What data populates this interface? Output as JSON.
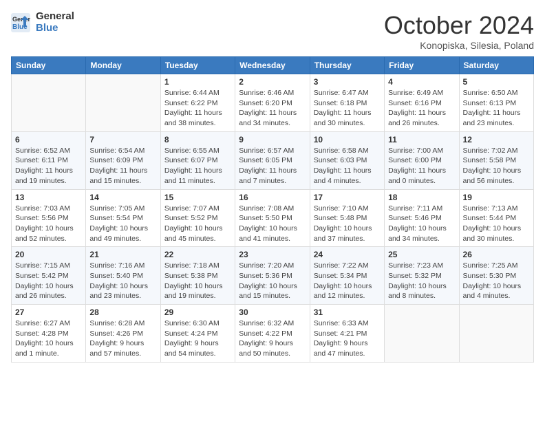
{
  "header": {
    "logo_line1": "General",
    "logo_line2": "Blue",
    "month_title": "October 2024",
    "location": "Konopiska, Silesia, Poland"
  },
  "days_of_week": [
    "Sunday",
    "Monday",
    "Tuesday",
    "Wednesday",
    "Thursday",
    "Friday",
    "Saturday"
  ],
  "weeks": [
    [
      {
        "day": "",
        "sunrise": "",
        "sunset": "",
        "daylight": ""
      },
      {
        "day": "",
        "sunrise": "",
        "sunset": "",
        "daylight": ""
      },
      {
        "day": "1",
        "sunrise": "Sunrise: 6:44 AM",
        "sunset": "Sunset: 6:22 PM",
        "daylight": "Daylight: 11 hours and 38 minutes."
      },
      {
        "day": "2",
        "sunrise": "Sunrise: 6:46 AM",
        "sunset": "Sunset: 6:20 PM",
        "daylight": "Daylight: 11 hours and 34 minutes."
      },
      {
        "day": "3",
        "sunrise": "Sunrise: 6:47 AM",
        "sunset": "Sunset: 6:18 PM",
        "daylight": "Daylight: 11 hours and 30 minutes."
      },
      {
        "day": "4",
        "sunrise": "Sunrise: 6:49 AM",
        "sunset": "Sunset: 6:16 PM",
        "daylight": "Daylight: 11 hours and 26 minutes."
      },
      {
        "day": "5",
        "sunrise": "Sunrise: 6:50 AM",
        "sunset": "Sunset: 6:13 PM",
        "daylight": "Daylight: 11 hours and 23 minutes."
      }
    ],
    [
      {
        "day": "6",
        "sunrise": "Sunrise: 6:52 AM",
        "sunset": "Sunset: 6:11 PM",
        "daylight": "Daylight: 11 hours and 19 minutes."
      },
      {
        "day": "7",
        "sunrise": "Sunrise: 6:54 AM",
        "sunset": "Sunset: 6:09 PM",
        "daylight": "Daylight: 11 hours and 15 minutes."
      },
      {
        "day": "8",
        "sunrise": "Sunrise: 6:55 AM",
        "sunset": "Sunset: 6:07 PM",
        "daylight": "Daylight: 11 hours and 11 minutes."
      },
      {
        "day": "9",
        "sunrise": "Sunrise: 6:57 AM",
        "sunset": "Sunset: 6:05 PM",
        "daylight": "Daylight: 11 hours and 7 minutes."
      },
      {
        "day": "10",
        "sunrise": "Sunrise: 6:58 AM",
        "sunset": "Sunset: 6:03 PM",
        "daylight": "Daylight: 11 hours and 4 minutes."
      },
      {
        "day": "11",
        "sunrise": "Sunrise: 7:00 AM",
        "sunset": "Sunset: 6:00 PM",
        "daylight": "Daylight: 11 hours and 0 minutes."
      },
      {
        "day": "12",
        "sunrise": "Sunrise: 7:02 AM",
        "sunset": "Sunset: 5:58 PM",
        "daylight": "Daylight: 10 hours and 56 minutes."
      }
    ],
    [
      {
        "day": "13",
        "sunrise": "Sunrise: 7:03 AM",
        "sunset": "Sunset: 5:56 PM",
        "daylight": "Daylight: 10 hours and 52 minutes."
      },
      {
        "day": "14",
        "sunrise": "Sunrise: 7:05 AM",
        "sunset": "Sunset: 5:54 PM",
        "daylight": "Daylight: 10 hours and 49 minutes."
      },
      {
        "day": "15",
        "sunrise": "Sunrise: 7:07 AM",
        "sunset": "Sunset: 5:52 PM",
        "daylight": "Daylight: 10 hours and 45 minutes."
      },
      {
        "day": "16",
        "sunrise": "Sunrise: 7:08 AM",
        "sunset": "Sunset: 5:50 PM",
        "daylight": "Daylight: 10 hours and 41 minutes."
      },
      {
        "day": "17",
        "sunrise": "Sunrise: 7:10 AM",
        "sunset": "Sunset: 5:48 PM",
        "daylight": "Daylight: 10 hours and 37 minutes."
      },
      {
        "day": "18",
        "sunrise": "Sunrise: 7:11 AM",
        "sunset": "Sunset: 5:46 PM",
        "daylight": "Daylight: 10 hours and 34 minutes."
      },
      {
        "day": "19",
        "sunrise": "Sunrise: 7:13 AM",
        "sunset": "Sunset: 5:44 PM",
        "daylight": "Daylight: 10 hours and 30 minutes."
      }
    ],
    [
      {
        "day": "20",
        "sunrise": "Sunrise: 7:15 AM",
        "sunset": "Sunset: 5:42 PM",
        "daylight": "Daylight: 10 hours and 26 minutes."
      },
      {
        "day": "21",
        "sunrise": "Sunrise: 7:16 AM",
        "sunset": "Sunset: 5:40 PM",
        "daylight": "Daylight: 10 hours and 23 minutes."
      },
      {
        "day": "22",
        "sunrise": "Sunrise: 7:18 AM",
        "sunset": "Sunset: 5:38 PM",
        "daylight": "Daylight: 10 hours and 19 minutes."
      },
      {
        "day": "23",
        "sunrise": "Sunrise: 7:20 AM",
        "sunset": "Sunset: 5:36 PM",
        "daylight": "Daylight: 10 hours and 15 minutes."
      },
      {
        "day": "24",
        "sunrise": "Sunrise: 7:22 AM",
        "sunset": "Sunset: 5:34 PM",
        "daylight": "Daylight: 10 hours and 12 minutes."
      },
      {
        "day": "25",
        "sunrise": "Sunrise: 7:23 AM",
        "sunset": "Sunset: 5:32 PM",
        "daylight": "Daylight: 10 hours and 8 minutes."
      },
      {
        "day": "26",
        "sunrise": "Sunrise: 7:25 AM",
        "sunset": "Sunset: 5:30 PM",
        "daylight": "Daylight: 10 hours and 4 minutes."
      }
    ],
    [
      {
        "day": "27",
        "sunrise": "Sunrise: 6:27 AM",
        "sunset": "Sunset: 4:28 PM",
        "daylight": "Daylight: 10 hours and 1 minute."
      },
      {
        "day": "28",
        "sunrise": "Sunrise: 6:28 AM",
        "sunset": "Sunset: 4:26 PM",
        "daylight": "Daylight: 9 hours and 57 minutes."
      },
      {
        "day": "29",
        "sunrise": "Sunrise: 6:30 AM",
        "sunset": "Sunset: 4:24 PM",
        "daylight": "Daylight: 9 hours and 54 minutes."
      },
      {
        "day": "30",
        "sunrise": "Sunrise: 6:32 AM",
        "sunset": "Sunset: 4:22 PM",
        "daylight": "Daylight: 9 hours and 50 minutes."
      },
      {
        "day": "31",
        "sunrise": "Sunrise: 6:33 AM",
        "sunset": "Sunset: 4:21 PM",
        "daylight": "Daylight: 9 hours and 47 minutes."
      },
      {
        "day": "",
        "sunrise": "",
        "sunset": "",
        "daylight": ""
      },
      {
        "day": "",
        "sunrise": "",
        "sunset": "",
        "daylight": ""
      }
    ]
  ]
}
